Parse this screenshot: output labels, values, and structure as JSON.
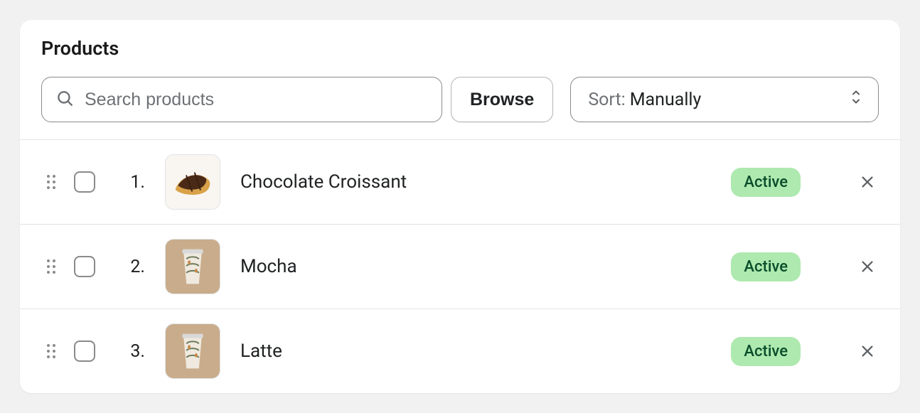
{
  "title": "Products",
  "search": {
    "placeholder": "Search products",
    "value": ""
  },
  "browse_label": "Browse",
  "sort": {
    "prefix": "Sort:",
    "value": "Manually"
  },
  "status_colors": {
    "active_bg": "#aee9af",
    "active_fg": "#0a4d2b"
  },
  "rows": [
    {
      "index": "1.",
      "name": "Chocolate Croissant",
      "status": "Active",
      "thumb": "croissant"
    },
    {
      "index": "2.",
      "name": "Mocha",
      "status": "Active",
      "thumb": "cup"
    },
    {
      "index": "3.",
      "name": "Latte",
      "status": "Active",
      "thumb": "cup"
    }
  ]
}
